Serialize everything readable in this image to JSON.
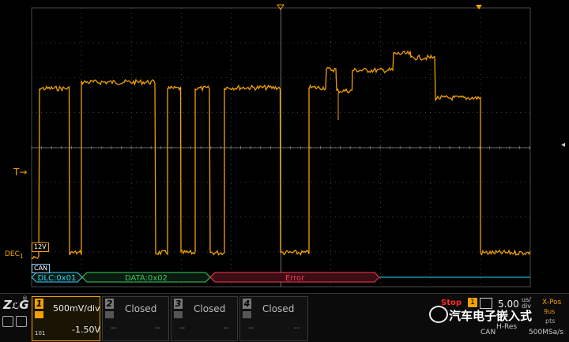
{
  "screen": {
    "title": "Oscilloscope CAN bus capture"
  },
  "trigger": {
    "label": "T",
    "arrow": "→"
  },
  "decode": {
    "label": "DEC",
    "sub": "1",
    "threshold_badge": "12V",
    "protocol_badge": "CAN"
  },
  "bus": {
    "frames": [
      {
        "label": "DLC:0x01",
        "color": "#37d1ff"
      },
      {
        "label": "DATA:0x02",
        "color": "#3ccc55"
      },
      {
        "label": "Error",
        "color": "#ff3b54"
      }
    ]
  },
  "channels": [
    {
      "num": "1",
      "scale": "500mV/div",
      "offset": "-1.50V",
      "state": "",
      "signal": "101"
    },
    {
      "num": "2",
      "state": "Closed",
      "dash1": "--",
      "dash2": "--"
    },
    {
      "num": "3",
      "state": "Closed",
      "dash1": "--",
      "dash2": "--"
    },
    {
      "num": "4",
      "state": "Closed",
      "dash1": "--",
      "dash2": "--"
    }
  ],
  "status": {
    "run_state": "Stop",
    "trigger_source": "1",
    "timebase_value": "5.00",
    "timebase_unit_top": "us/",
    "timebase_unit_bottom": "div",
    "xpos_label": "X-Pos",
    "xpos_value": "9us",
    "points": "pts",
    "acq_mode": "H-Res",
    "sample_rate": "500MSa/s",
    "protocol": "CAN"
  },
  "brand": {
    "logo": "ZLG",
    "reg": "®"
  },
  "watermark": {
    "text": "汽车电子嵌入式"
  },
  "colors": {
    "trace": "#f0a000",
    "grid": "#5a5a5a",
    "accent": "#f0a000"
  }
}
